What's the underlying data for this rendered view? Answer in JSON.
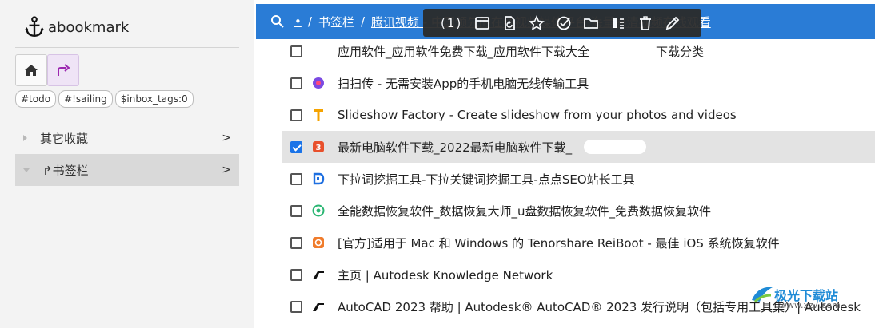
{
  "app": {
    "title": "abookmark"
  },
  "sidebar": {
    "tags": [
      "#todo",
      "#!sailing",
      "$inbox_tags:0"
    ],
    "folders": [
      {
        "label": "其它收藏",
        "arrow": ">"
      },
      {
        "label": "↱书签栏",
        "arrow": ">"
      }
    ]
  },
  "header": {
    "crumb_dot": "•",
    "crumb_sep": "/",
    "crumb_folder": "书签栏",
    "crumb_current": "腾讯视频 - 中国领先的在线视频媒体平台,海量高清视频在线观看",
    "selection_count": "(1)"
  },
  "toolbar": {
    "icons": [
      "window-icon",
      "refresh-tab-icon",
      "star-icon",
      "check-circle-icon",
      "folder-icon",
      "columns-icon",
      "trash-icon",
      "edit-icon"
    ]
  },
  "list": [
    {
      "title": "应用软件_应用软件免费下载_应用软件下载大全",
      "title_suffix": "下载分类",
      "checked": false,
      "icon": "none"
    },
    {
      "title": "扫扫传 - 无需安装App的手机电脑无线传输工具",
      "checked": false,
      "icon": "scan-transfer-icon"
    },
    {
      "title": "Slideshow Factory - Create slideshow from your photos and videos",
      "checked": false,
      "icon": "slideshow-icon"
    },
    {
      "title": "最新电脑软件下载_2022最新电脑软件下载_",
      "checked": true,
      "icon": "software-download-icon"
    },
    {
      "title": "下拉词挖掘工具-下拉关键词挖掘工具-点点SEO站长工具",
      "checked": false,
      "icon": "seo-tool-icon"
    },
    {
      "title": "全能数据恢复软件_数据恢复大师_u盘数据恢复软件_免费数据恢复软件",
      "checked": false,
      "icon": "data-recovery-icon"
    },
    {
      "title": "[官方]适用于 Mac 和 Windows 的 Tenorshare ReiBoot - 最佳 iOS 系统恢复软件",
      "checked": false,
      "icon": "tenorshare-icon"
    },
    {
      "title": "主页 | Autodesk Knowledge Network",
      "checked": false,
      "icon": "autodesk-icon"
    },
    {
      "title": "AutoCAD 2023 帮助 | Autodesk® AutoCAD® 2023 发行说明（包括专用工具集）| Autodesk",
      "checked": false,
      "icon": "autodesk-icon"
    }
  ],
  "watermark": {
    "main": "极光下载站",
    "sub": "www.xz7.com"
  },
  "colors": {
    "header": "#2a7cd6",
    "toolbar": "#2b2b2b",
    "checked_row": "#e3e3e3",
    "sidebar": "#f3f3f3",
    "accent_purple": "#9c27b0"
  }
}
